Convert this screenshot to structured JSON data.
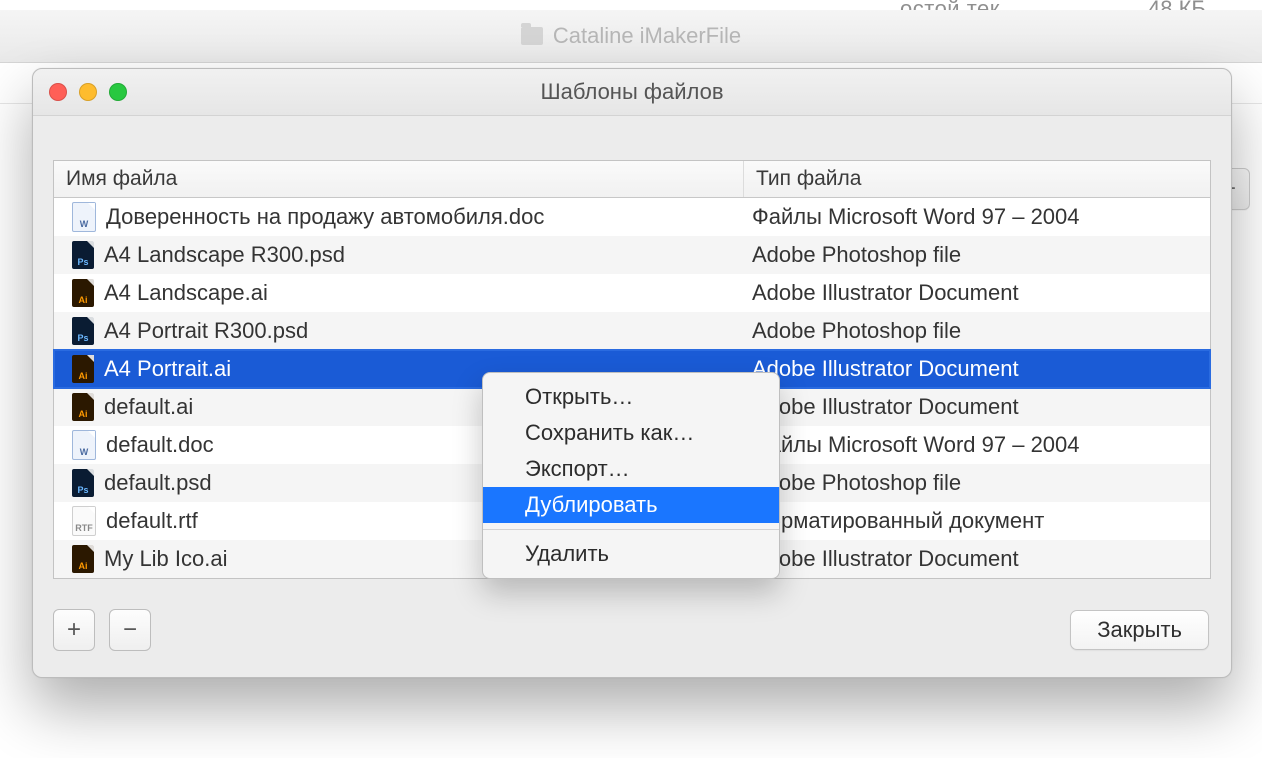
{
  "background": {
    "partial_text": "остой тек",
    "partial_size": "48 КБ",
    "window_title": "Cataline iMakerFile"
  },
  "sheet": {
    "title": "Шаблоны файлов",
    "columns": {
      "name": "Имя файла",
      "type": "Тип файла"
    },
    "rows": [
      {
        "icon": "doc",
        "name": "Доверенность на продажу автомобиля.doc",
        "type": "Файлы Microsoft Word 97 – 2004",
        "selected": false
      },
      {
        "icon": "psd",
        "name": "A4 Landscape R300.psd",
        "type": "Adobe Photoshop file",
        "selected": false
      },
      {
        "icon": "ai",
        "name": "A4 Landscape.ai",
        "type": "Adobe Illustrator Document",
        "selected": false
      },
      {
        "icon": "psd",
        "name": "A4 Portrait R300.psd",
        "type": "Adobe Photoshop file",
        "selected": false
      },
      {
        "icon": "ai",
        "name": "A4 Portrait.ai",
        "type": "Adobe Illustrator Document",
        "selected": true
      },
      {
        "icon": "ai",
        "name": "default.ai",
        "type": "Adobe Illustrator Document",
        "selected": false
      },
      {
        "icon": "doc",
        "name": "default.doc",
        "type": "Файлы Microsoft Word 97 – 2004",
        "selected": false
      },
      {
        "icon": "psd",
        "name": "default.psd",
        "type": "Adobe Photoshop file",
        "selected": false
      },
      {
        "icon": "rtf",
        "name": "default.rtf",
        "type": "Форматированный документ",
        "selected": false
      },
      {
        "icon": "ai",
        "name": "My Lib Ico.ai",
        "type": "Adobe Illustrator Document",
        "selected": false
      }
    ],
    "buttons": {
      "add": "+",
      "remove": "−",
      "close": "Закрыть"
    }
  },
  "context_menu": {
    "open": "Открыть…",
    "save_as": "Сохранить как…",
    "export": "Экспорт…",
    "duplicate": "Дублировать",
    "delete": "Удалить"
  },
  "icon_labels": {
    "doc": "W",
    "psd": "Ps",
    "ai": "Ai",
    "rtf": "RTF"
  }
}
